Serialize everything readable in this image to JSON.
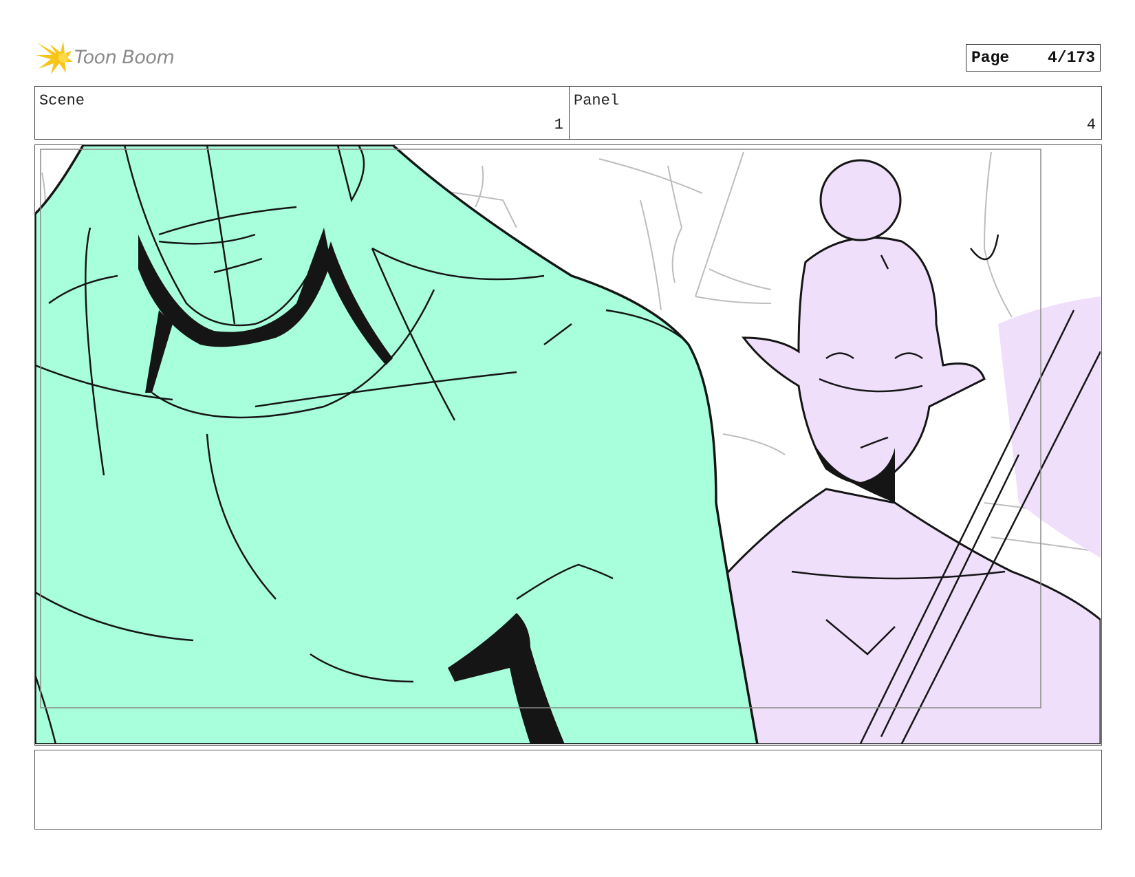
{
  "brand": {
    "name": "Toon Boom",
    "accent": "#f7c515"
  },
  "page": {
    "label": "Page",
    "number": "4/173"
  },
  "header": {
    "scene": {
      "label": "Scene",
      "value": "1"
    },
    "panel": {
      "label": "Panel",
      "value": "4"
    }
  },
  "colors": {
    "character_left": "#a8ffdc",
    "character_right": "#efdffb",
    "ink": "#151515",
    "background_lines": "#bdbdbd"
  },
  "notes": {
    "text": ""
  }
}
